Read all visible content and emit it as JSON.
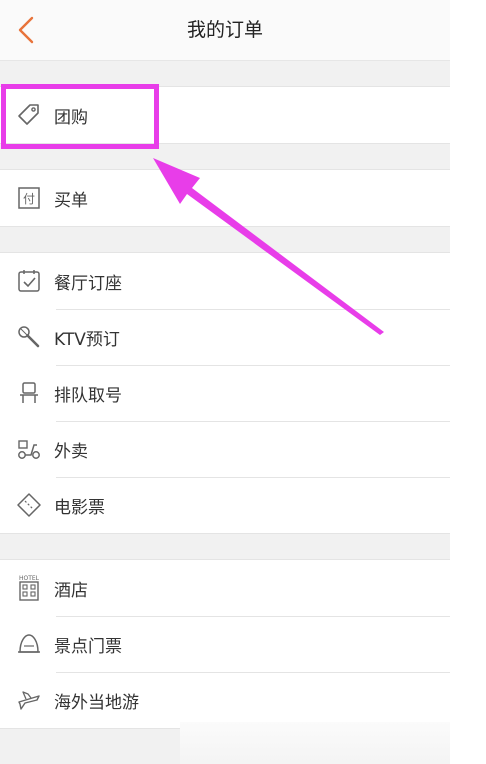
{
  "header": {
    "title": "我的订单",
    "back_icon": "chevron-left-icon"
  },
  "groups": [
    {
      "items": [
        {
          "label": "团购",
          "icon": "tag-icon"
        }
      ]
    },
    {
      "items": [
        {
          "label": "买单",
          "icon": "pay-bill-icon",
          "icon_text": "付"
        }
      ]
    },
    {
      "items": [
        {
          "label": "餐厅订座",
          "icon": "calendar-check-icon"
        },
        {
          "label": "KTV预订",
          "icon": "microphone-icon"
        },
        {
          "label": "排队取号",
          "icon": "chair-icon"
        },
        {
          "label": "外卖",
          "icon": "scooter-icon"
        },
        {
          "label": "电影票",
          "icon": "ticket-icon"
        }
      ]
    },
    {
      "items": [
        {
          "label": "酒店",
          "icon": "hotel-icon",
          "icon_text": "HOTEL"
        },
        {
          "label": "景点门票",
          "icon": "landmark-icon"
        },
        {
          "label": "海外当地游",
          "icon": "airplane-icon"
        }
      ]
    }
  ],
  "colors": {
    "accent_back": "#e8733a",
    "annotation": "#e83de9",
    "icon": "#666666"
  }
}
